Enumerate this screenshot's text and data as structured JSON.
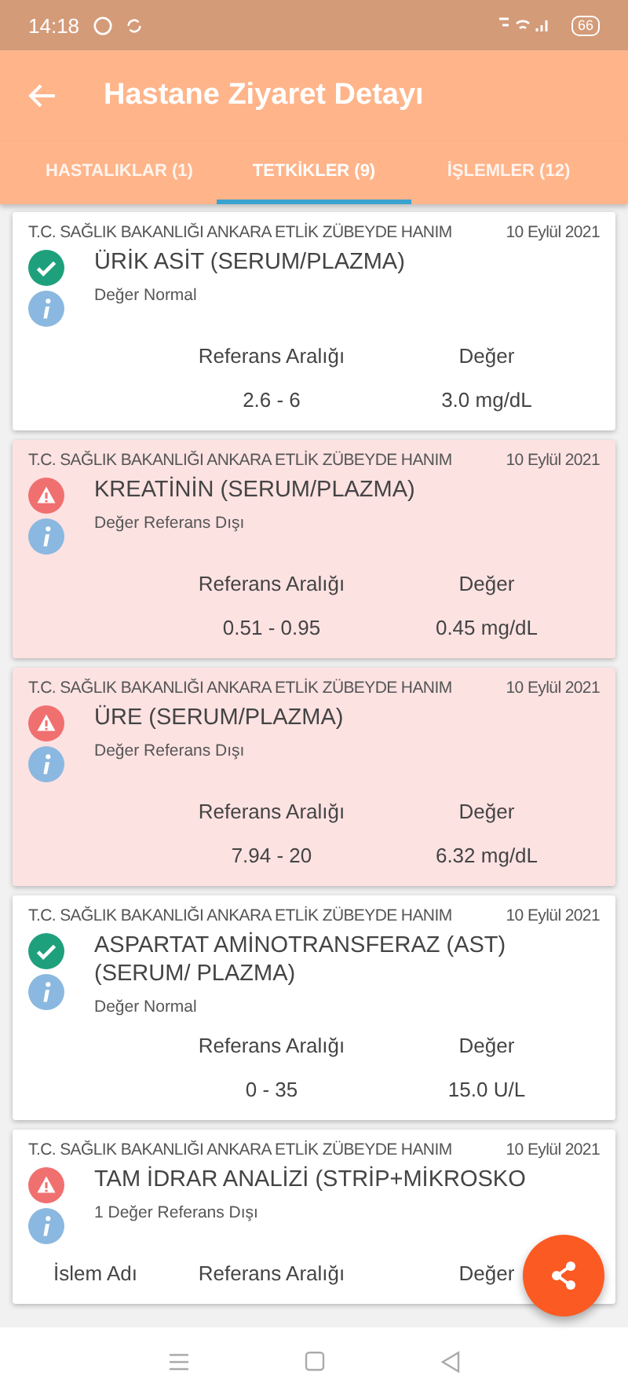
{
  "status_bar": {
    "time": "14:18",
    "battery": "66"
  },
  "app_bar": {
    "title": "Hastane Ziyaret Detayı"
  },
  "tabs": [
    {
      "label": "HASTALIKLAR (1)",
      "selected": false
    },
    {
      "label": "TETKİKLER (9)",
      "selected": true
    },
    {
      "label": "İŞLEMLER (12)",
      "selected": false
    }
  ],
  "tests": [
    {
      "hospital": "T.C. SAĞLIK BAKANLIĞI ANKARA ETLİK ZÜBEYDE HANIM",
      "date": "10 Eylül 2021",
      "kind": "normal",
      "title": "ÜRİK ASİT (SERUM/PLAZMA)",
      "status": "Değer Normal",
      "columns": [
        "Referans Aralığı",
        "Değer"
      ],
      "rows": [
        [
          "2.6 - 6",
          "3.0 mg/dL"
        ]
      ]
    },
    {
      "hospital": "T.C. SAĞLIK BAKANLIĞI ANKARA ETLİK ZÜBEYDE HANIM",
      "date": "10 Eylül 2021",
      "kind": "alert",
      "title": "KREATİNİN (SERUM/PLAZMA)",
      "status": "Değer Referans Dışı",
      "columns": [
        "Referans Aralığı",
        "Değer"
      ],
      "rows": [
        [
          "0.51 - 0.95",
          "0.45 mg/dL"
        ]
      ]
    },
    {
      "hospital": "T.C. SAĞLIK BAKANLIĞI ANKARA ETLİK ZÜBEYDE HANIM",
      "date": "10 Eylül 2021",
      "kind": "alert",
      "title": "ÜRE (SERUM/PLAZMA)",
      "status": "Değer Referans Dışı",
      "columns": [
        "Referans Aralığı",
        "Değer"
      ],
      "rows": [
        [
          "7.94 - 20",
          "6.32 mg/dL"
        ]
      ]
    },
    {
      "hospital": "T.C. SAĞLIK BAKANLIĞI ANKARA ETLİK ZÜBEYDE HANIM",
      "date": "10 Eylül 2021",
      "kind": "normal",
      "title": "ASPARTAT AMİNOTRANSFERAZ (AST) (SERUM/ PLAZMA)",
      "status": "Değer Normal",
      "columns": [
        "Referans Aralığı",
        "Değer"
      ],
      "rows": [
        [
          "0 - 35",
          "15.0 U/L"
        ]
      ]
    },
    {
      "hospital": "T.C. SAĞLIK BAKANLIĞI ANKARA ETLİK ZÜBEYDE HANIM",
      "date": "10 Eylül 2021",
      "kind": "warning",
      "title": "TAM İDRAR ANALİZİ (STRİP+MİKROSKO",
      "status": "1 Değer Referans Dışı",
      "columns": [
        "İslem Adı",
        "Referans Aralığı",
        "Değer"
      ]
    }
  ]
}
